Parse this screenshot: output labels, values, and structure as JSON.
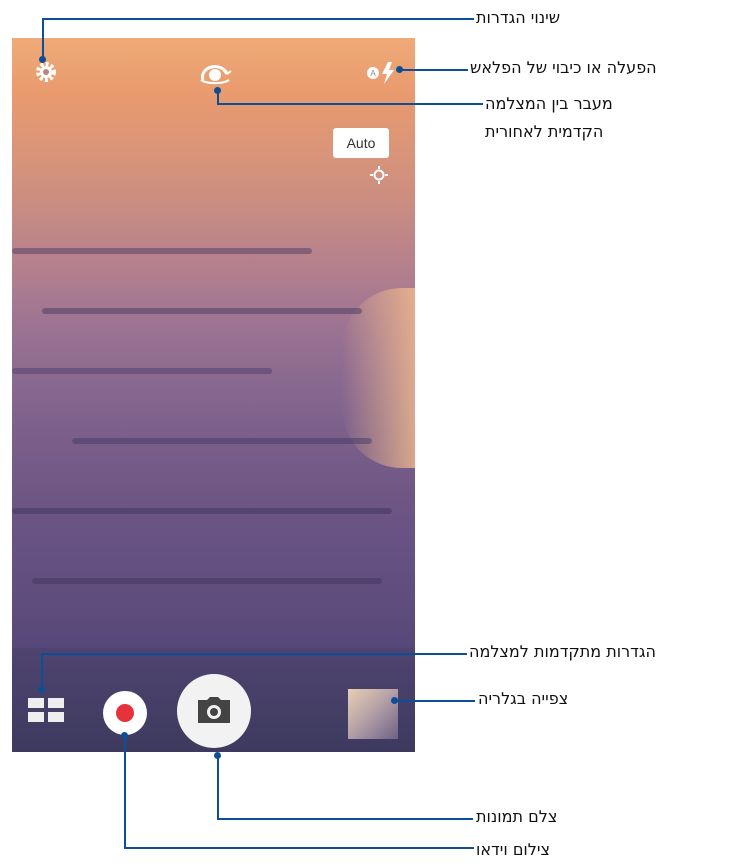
{
  "screen": {
    "auto_label": "Auto",
    "icons": {
      "settings": "gear-icon",
      "switch_camera": "camera-switch-icon",
      "flash": "flash-auto-icon",
      "exposure": "exposure-icon",
      "advanced": "grid-icon",
      "shutter": "camera-icon"
    },
    "colors": {
      "callout": "#0d4f97",
      "record": "#e5323b"
    }
  },
  "labels": {
    "settings": "שינוי הגדרות",
    "flash": "הפעלה או כיבוי של הפלאש",
    "switch_line1": "מעבר בין המצלמה",
    "switch_line2": "הקדמית לאחורית",
    "advanced": "הגדרות מתקדמות למצלמה",
    "gallery": "צפייה בגלריה",
    "photo": "צלם תמונות",
    "video": "צילום וידאו"
  }
}
